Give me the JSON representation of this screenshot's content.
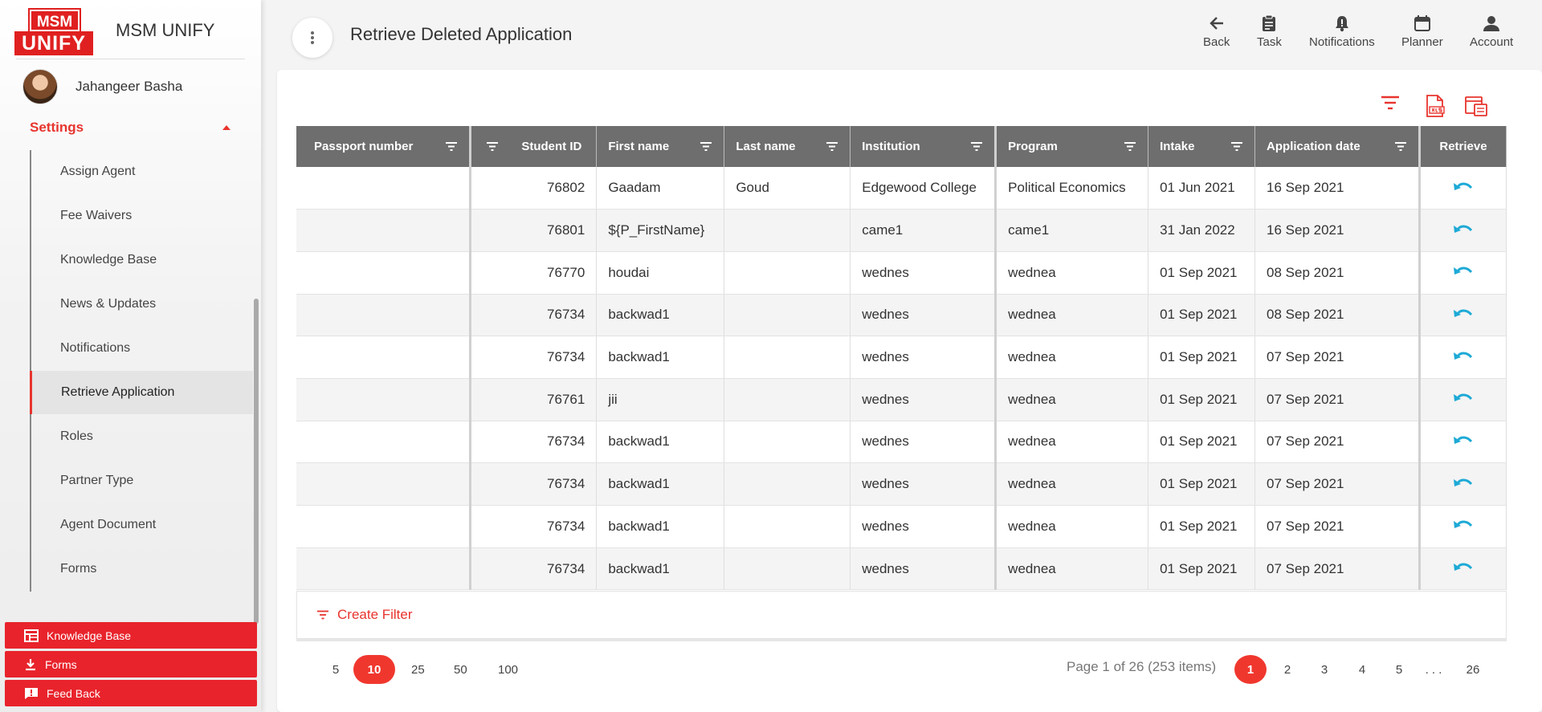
{
  "brand": {
    "logo_top": "MSM",
    "logo_bottom": "UNIFY",
    "app_name": "MSM UNIFY"
  },
  "user": {
    "name": "Jahangeer Basha"
  },
  "sidebar": {
    "section_label": "Settings",
    "items": [
      {
        "label": "Assign Agent"
      },
      {
        "label": "Fee Waivers"
      },
      {
        "label": "Knowledge Base"
      },
      {
        "label": "News & Updates"
      },
      {
        "label": "Notifications"
      },
      {
        "label": "Retrieve Application"
      },
      {
        "label": "Roles"
      },
      {
        "label": "Partner Type"
      },
      {
        "label": "Agent Document"
      },
      {
        "label": "Forms"
      }
    ],
    "active_item": "Retrieve Application",
    "bottom_buttons": [
      {
        "label": "Knowledge Base",
        "icon": "knowledge-base-icon"
      },
      {
        "label": "Forms",
        "icon": "download-icon"
      },
      {
        "label": "Feed Back",
        "icon": "feedback-icon"
      }
    ]
  },
  "header": {
    "title": "Retrieve Deleted Application",
    "actions": [
      {
        "label": "Back",
        "icon": "arrow-left-icon"
      },
      {
        "label": "Task",
        "icon": "clipboard-icon"
      },
      {
        "label": "Notifications",
        "icon": "bell-icon"
      },
      {
        "label": "Planner",
        "icon": "calendar-icon"
      },
      {
        "label": "Account",
        "icon": "person-icon"
      }
    ]
  },
  "table": {
    "columns": [
      "Passport number",
      "Student ID",
      "First name",
      "Last name",
      "Institution",
      "Program",
      "Intake",
      "Application date",
      "Retrieve"
    ],
    "rows": [
      {
        "passport": "",
        "student_id": "76802",
        "first_name": "Gaadam",
        "last_name": "Goud",
        "institution": "Edgewood College",
        "program": "Political Economics",
        "intake": "01 Jun 2021",
        "app_date": "16 Sep 2021"
      },
      {
        "passport": "",
        "student_id": "76801",
        "first_name": "${P_FirstName}",
        "last_name": "",
        "institution": "came1",
        "program": "came1",
        "intake": "31 Jan 2022",
        "app_date": "16 Sep 2021"
      },
      {
        "passport": "",
        "student_id": "76770",
        "first_name": "houdai",
        "last_name": "",
        "institution": "wednes",
        "program": "wednea",
        "intake": "01 Sep 2021",
        "app_date": "08 Sep 2021"
      },
      {
        "passport": "",
        "student_id": "76734",
        "first_name": "backwad1",
        "last_name": "",
        "institution": "wednes",
        "program": "wednea",
        "intake": "01 Sep 2021",
        "app_date": "08 Sep 2021"
      },
      {
        "passport": "",
        "student_id": "76734",
        "first_name": "backwad1",
        "last_name": "",
        "institution": "wednes",
        "program": "wednea",
        "intake": "01 Sep 2021",
        "app_date": "07 Sep 2021"
      },
      {
        "passport": "",
        "student_id": "76761",
        "first_name": "jii",
        "last_name": "",
        "institution": "wednes",
        "program": "wednea",
        "intake": "01 Sep 2021",
        "app_date": "07 Sep 2021"
      },
      {
        "passport": "",
        "student_id": "76734",
        "first_name": "backwad1",
        "last_name": "",
        "institution": "wednes",
        "program": "wednea",
        "intake": "01 Sep 2021",
        "app_date": "07 Sep 2021"
      },
      {
        "passport": "",
        "student_id": "76734",
        "first_name": "backwad1",
        "last_name": "",
        "institution": "wednes",
        "program": "wednea",
        "intake": "01 Sep 2021",
        "app_date": "07 Sep 2021"
      },
      {
        "passport": "",
        "student_id": "76734",
        "first_name": "backwad1",
        "last_name": "",
        "institution": "wednes",
        "program": "wednea",
        "intake": "01 Sep 2021",
        "app_date": "07 Sep 2021"
      },
      {
        "passport": "",
        "student_id": "76734",
        "first_name": "backwad1",
        "last_name": "",
        "institution": "wednes",
        "program": "wednea",
        "intake": "01 Sep 2021",
        "app_date": "07 Sep 2021"
      }
    ]
  },
  "create_filter_label": "Create Filter",
  "pager": {
    "page_sizes": [
      "5",
      "10",
      "25",
      "50",
      "100"
    ],
    "selected_page_size": "10",
    "info": "Page 1 of 26 (253 items)",
    "pages": [
      "1",
      "2",
      "3",
      "4",
      "5",
      ". . .",
      "26"
    ],
    "current_page": "1"
  },
  "colors": {
    "accent": "#e8342e",
    "header_bg": "#6e6e6e",
    "retrieve_icon": "#1eaad6",
    "bottom_button": "#e8232b"
  }
}
